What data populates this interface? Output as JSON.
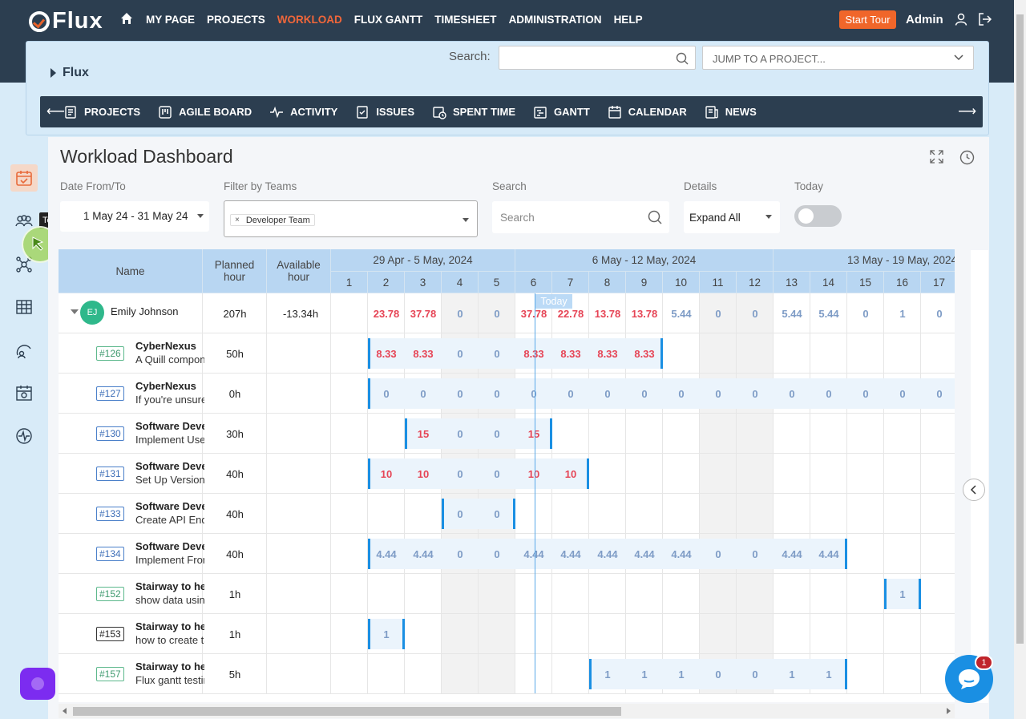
{
  "topnav": {
    "brand": "Flux",
    "menu": [
      "MY PAGE",
      "PROJECTS",
      "WORKLOAD",
      "FLUX GANTT",
      "TIMESHEET",
      "ADMINISTRATION",
      "HELP"
    ],
    "active": "WORKLOAD",
    "start_tour": "Start Tour",
    "user": "Admin"
  },
  "project": {
    "name": "Flux",
    "search_label": "Search:",
    "search_value": "",
    "jump_placeholder": "JUMP TO A PROJECT..."
  },
  "subnav": {
    "items": [
      {
        "label": "PROJECTS",
        "icon": "projects-icon"
      },
      {
        "label": "AGILE BOARD",
        "icon": "agile-board-icon"
      },
      {
        "label": "ACTIVITY",
        "icon": "activity-icon"
      },
      {
        "label": "ISSUES",
        "icon": "issues-icon"
      },
      {
        "label": "SPENT TIME",
        "icon": "spent-time-icon"
      },
      {
        "label": "GANTT",
        "icon": "gantt-icon"
      },
      {
        "label": "CALENDAR",
        "icon": "calendar-icon"
      },
      {
        "label": "NEWS",
        "icon": "news-icon"
      }
    ]
  },
  "sidebar": {
    "tooltip": "Teams"
  },
  "dashboard": {
    "title": "Workload Dashboard",
    "filters": {
      "date_label": "Date From/To",
      "date_value": "1 May 24 - 31 May 24",
      "teams_label": "Filter by Teams",
      "team_chip": "Developer Team",
      "search_label": "Search",
      "search_placeholder": "Search",
      "details_label": "Details",
      "details_value": "Expand All",
      "today_label": "Today",
      "today_on": false
    },
    "columns": {
      "name": "Name",
      "planned": "Planned hour",
      "available": "Available hour"
    },
    "weeks": [
      "29 Apr - 5 May, 2024",
      "6 May - 12 May, 2024",
      "13 May - 19 May, 2024"
    ],
    "days": [
      "1",
      "2",
      "3",
      "4",
      "5",
      "6",
      "7",
      "8",
      "9",
      "10",
      "11",
      "12",
      "13",
      "14",
      "15",
      "16",
      "17"
    ],
    "today_label": "Today",
    "user": {
      "initials": "EJ",
      "name": "Emily Johnson",
      "planned": "207h",
      "available": "-13.34h",
      "daily": [
        "",
        "23.78",
        "37.78",
        "0",
        "0",
        "37.78",
        "22.78",
        "13.78",
        "13.78",
        "5.44",
        "0",
        "0",
        "5.44",
        "5.44",
        "0",
        "1",
        "0"
      ]
    },
    "tasks": [
      {
        "id": "#126",
        "color": "green",
        "project": "CyberNexus",
        "subject": "A Quill component for rich text",
        "planned": "50h",
        "start": 1,
        "values": [
          "8.33",
          "8.33",
          "0",
          "0",
          "8.33",
          "8.33",
          "8.33",
          "8.33"
        ]
      },
      {
        "id": "#127",
        "color": "blue",
        "project": "CyberNexus",
        "subject": "If you're unsure what to do",
        "planned": "0h",
        "start": 1,
        "values": [
          "0",
          "0",
          "0",
          "0",
          "0",
          "0",
          "0",
          "0",
          "0",
          "0",
          "0",
          "0",
          "0",
          "0",
          "0",
          "0"
        ]
      },
      {
        "id": "#130",
        "color": "blue",
        "project": "Software Development",
        "subject": "Implement User Authentication",
        "planned": "30h",
        "start": 2,
        "values": [
          "15",
          "0",
          "0",
          "15"
        ]
      },
      {
        "id": "#131",
        "color": "blue",
        "project": "Software Development",
        "subject": "Set Up Version Control",
        "planned": "40h",
        "start": 1,
        "values": [
          "10",
          "10",
          "0",
          "0",
          "10",
          "10"
        ]
      },
      {
        "id": "#133",
        "color": "blue",
        "project": "Software Development",
        "subject": "Create API Endpoints",
        "planned": "40h",
        "start": 3,
        "values": [
          "0",
          "0"
        ]
      },
      {
        "id": "#134",
        "color": "blue",
        "project": "Software Development",
        "subject": "Implement Frontend",
        "planned": "40h",
        "start": 1,
        "values": [
          "4.44",
          "4.44",
          "0",
          "0",
          "4.44",
          "4.44",
          "4.44",
          "4.44",
          "4.44",
          "0",
          "0",
          "4.44",
          "4.44"
        ]
      },
      {
        "id": "#152",
        "color": "green",
        "project": "Stairway to heaven",
        "subject": "show data using charts",
        "planned": "1h",
        "start": 15,
        "values": [
          "1"
        ]
      },
      {
        "id": "#153",
        "color": "black",
        "project": "Stairway to heaven",
        "subject": "how to create tasks",
        "planned": "1h",
        "start": 1,
        "values": [
          "1"
        ]
      },
      {
        "id": "#157",
        "color": "green",
        "project": "Stairway to heaven",
        "subject": "Flux gantt testing",
        "planned": "5h",
        "start": 7,
        "values": [
          "1",
          "1",
          "1",
          "0",
          "0",
          "1",
          "1"
        ]
      }
    ]
  },
  "chat": {
    "badge": "1"
  }
}
